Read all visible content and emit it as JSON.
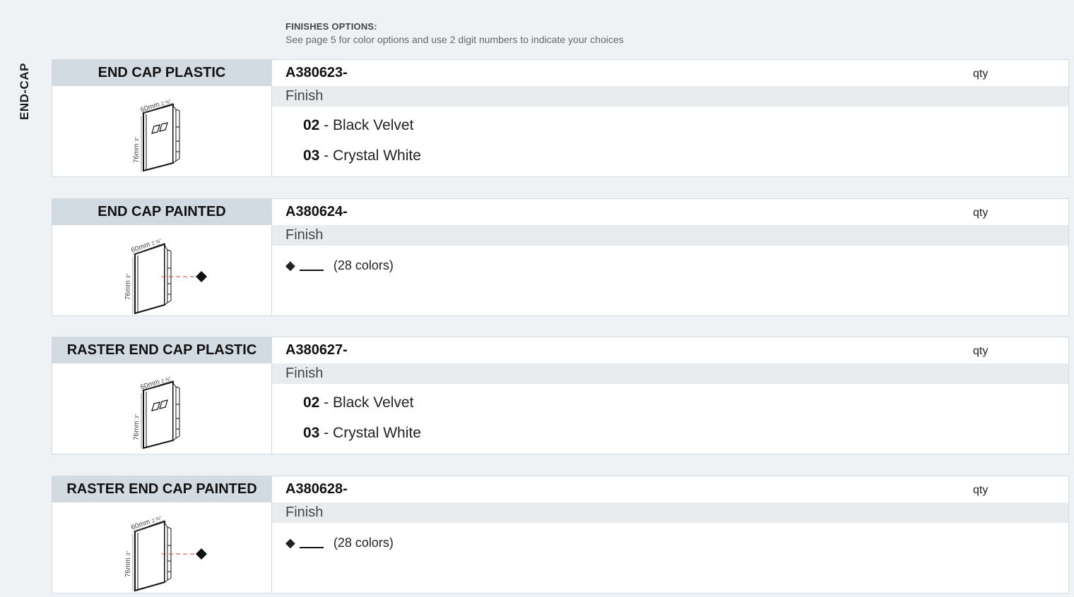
{
  "section_label": "END-CAP",
  "header": {
    "title": "FINISHES OPTIONS:",
    "subtitle": "See page 5 for color options and use 2 digit numbers to indicate your choices"
  },
  "products": [
    {
      "name": "END CAP PLASTIC",
      "code": "A380623-",
      "qty_label": "qty",
      "finish_label": "Finish",
      "type": "plastic",
      "options": [
        {
          "code": "02",
          "label": "- Black Velvet"
        },
        {
          "code": "03",
          "label": "- Crystal White"
        }
      ],
      "drawing": {
        "width_label": "60mm",
        "width_in": "2 ⅜\"",
        "height_label": "76mm",
        "height_in": "3\""
      }
    },
    {
      "name": "END CAP PAINTED",
      "code": "A380624-",
      "qty_label": "qty",
      "finish_label": "Finish",
      "type": "painted",
      "paint_symbol": "◆",
      "paint_text": "(28 colors)",
      "drawing": {
        "width_label": "60mm",
        "width_in": "2 ⅜\"",
        "height_label": "76mm",
        "height_in": "3\""
      }
    },
    {
      "name": "RASTER END CAP PLASTIC",
      "code": "A380627-",
      "qty_label": "qty",
      "finish_label": "Finish",
      "type": "plastic",
      "options": [
        {
          "code": "02",
          "label": "- Black Velvet"
        },
        {
          "code": "03",
          "label": "- Crystal White"
        }
      ],
      "drawing": {
        "width_label": "60mm",
        "width_in": "2 ⅜\"",
        "height_label": "76mm",
        "height_in": "3\""
      }
    },
    {
      "name": "RASTER END CAP PAINTED",
      "code": "A380628-",
      "qty_label": "qty",
      "finish_label": "Finish",
      "type": "painted",
      "paint_symbol": "◆",
      "paint_text": "(28 colors)",
      "drawing": {
        "width_label": "60mm",
        "width_in": "2 ⅜\"",
        "height_label": "76mm",
        "height_in": "3\""
      }
    }
  ]
}
